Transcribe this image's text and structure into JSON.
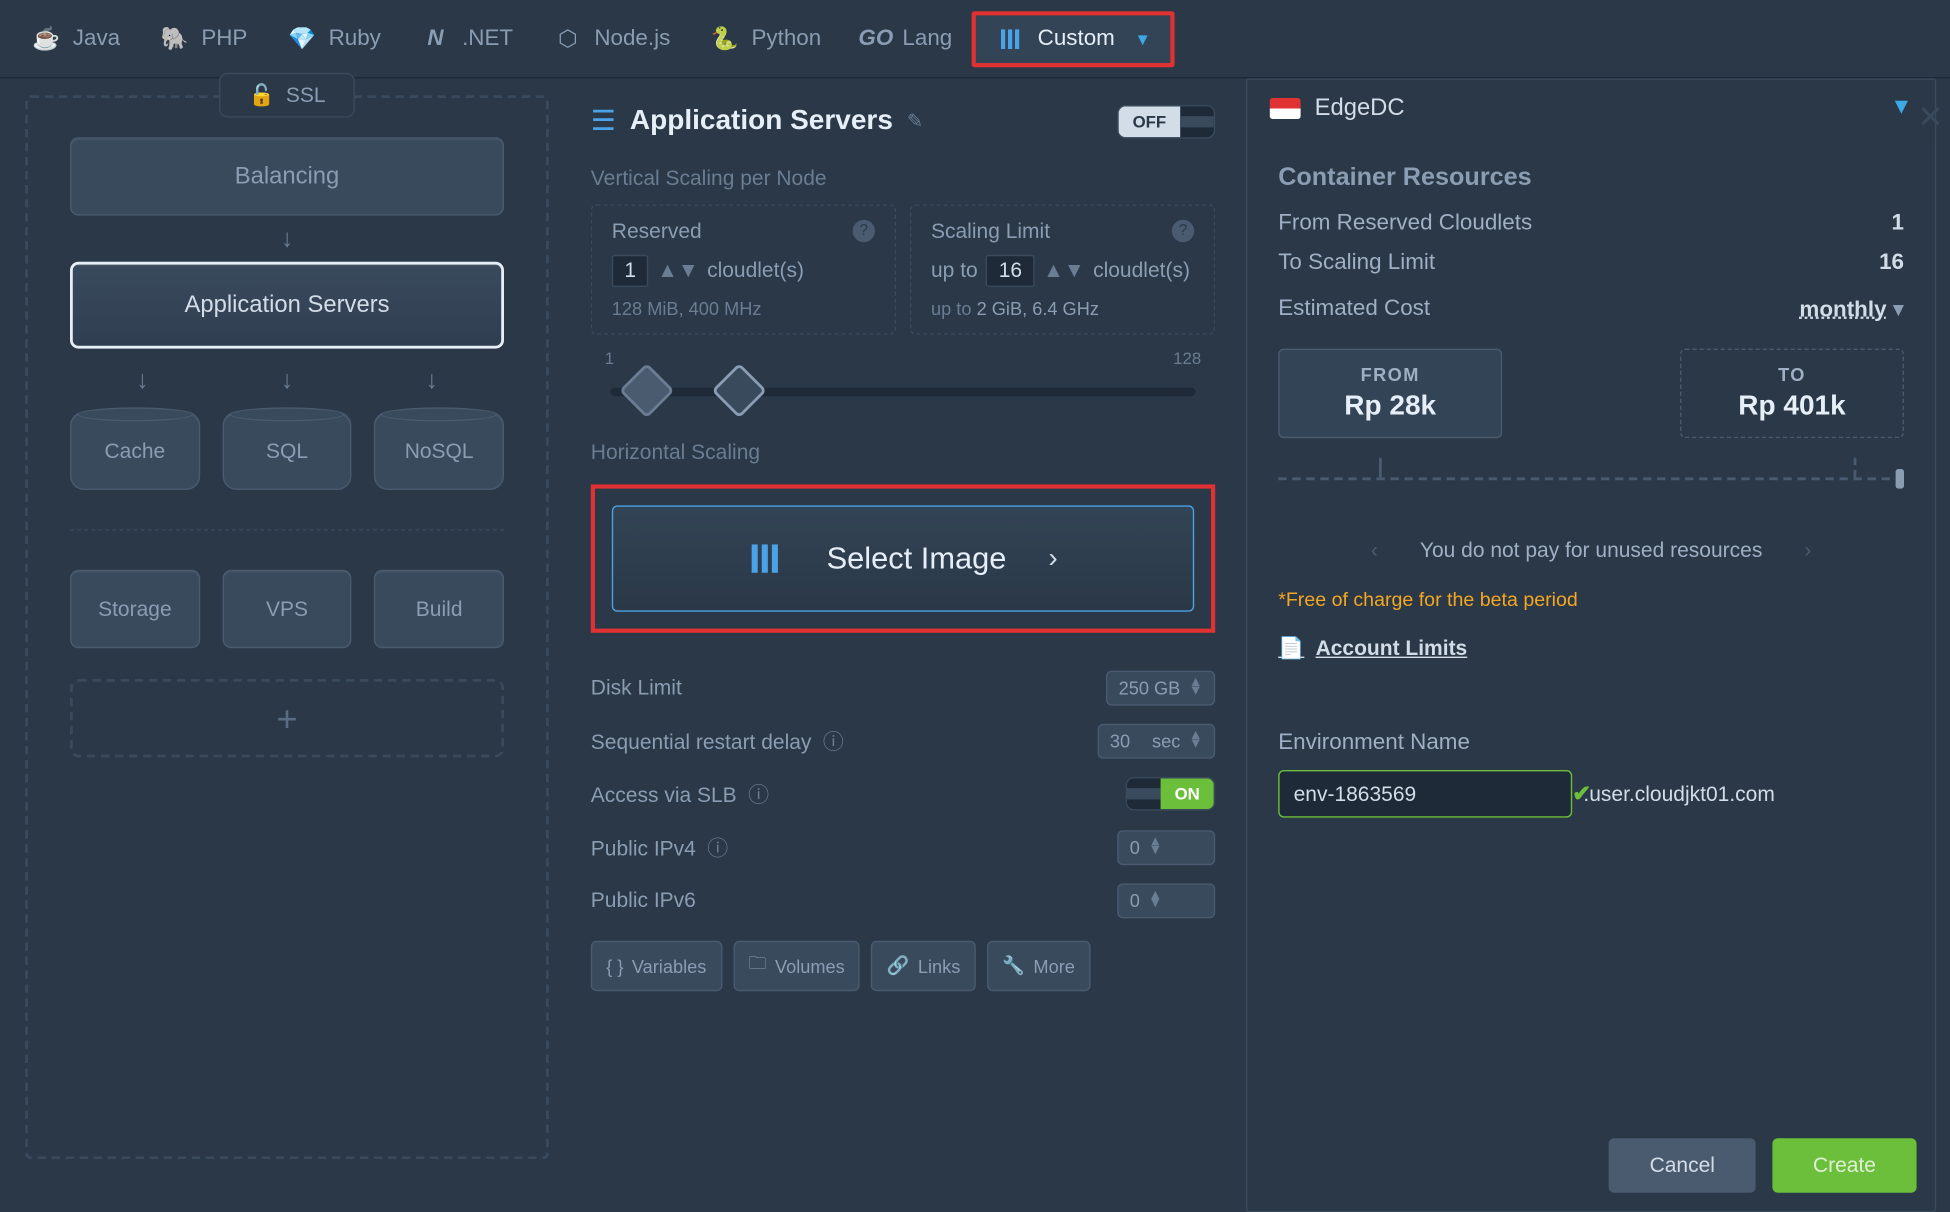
{
  "tabs": {
    "java": "Java",
    "php": "PHP",
    "ruby": "Ruby",
    "dotnet": ".NET",
    "node": "Node.js",
    "python": "Python",
    "lang": "Lang",
    "custom": "Custom"
  },
  "region": {
    "name": "EdgeDC"
  },
  "left": {
    "ssl": "SSL",
    "balancing": "Balancing",
    "app_servers": "Application Servers",
    "cache": "Cache",
    "sql": "SQL",
    "nosql": "NoSQL",
    "storage": "Storage",
    "vps": "VPS",
    "build": "Build"
  },
  "center": {
    "title": "Application Servers",
    "off": "OFF",
    "vertical_label": "Vertical Scaling per Node",
    "reserved": {
      "title": "Reserved",
      "value": "1",
      "unit": "cloudlet(s)",
      "detail": "128 MiB, 400 MHz"
    },
    "limit": {
      "title": "Scaling Limit",
      "prefix": "up to",
      "value": "16",
      "unit": "cloudlet(s)",
      "detail_prefix": "up to",
      "detail": "2 GiB, 6.4 GHz"
    },
    "slider_min": "1",
    "slider_max": "128",
    "horizontal_label": "Horizontal Scaling",
    "select_image": "Select Image",
    "disk_limit": {
      "label": "Disk Limit",
      "value": "250 GB"
    },
    "restart_delay": {
      "label": "Sequential restart delay",
      "value": "30",
      "unit": "sec"
    },
    "slb": {
      "label": "Access via SLB",
      "value": "ON"
    },
    "ipv4": {
      "label": "Public IPv4",
      "value": "0"
    },
    "ipv6": {
      "label": "Public IPv6",
      "value": "0"
    },
    "buttons": {
      "vars": "Variables",
      "vols": "Volumes",
      "links": "Links",
      "more": "More"
    }
  },
  "right": {
    "title": "Container Resources",
    "from_reserved": {
      "label": "From Reserved Cloudlets",
      "value": "1"
    },
    "to_limit": {
      "label": "To Scaling Limit",
      "value": "16"
    },
    "estimated": {
      "label": "Estimated Cost",
      "period": "monthly"
    },
    "cost_from": {
      "label": "FROM",
      "value": "Rp 28k"
    },
    "cost_to": {
      "label": "TO",
      "value": "Rp 401k"
    },
    "pay_note": "You do not pay for unused resources",
    "free_note": "*Free of charge for the beta period",
    "account_limits": "Account Limits",
    "env_name_label": "Environment Name",
    "env_name_value": "env-1863569",
    "domain_suffix": ".user.cloudjkt01.com"
  },
  "footer": {
    "cancel": "Cancel",
    "create": "Create"
  }
}
